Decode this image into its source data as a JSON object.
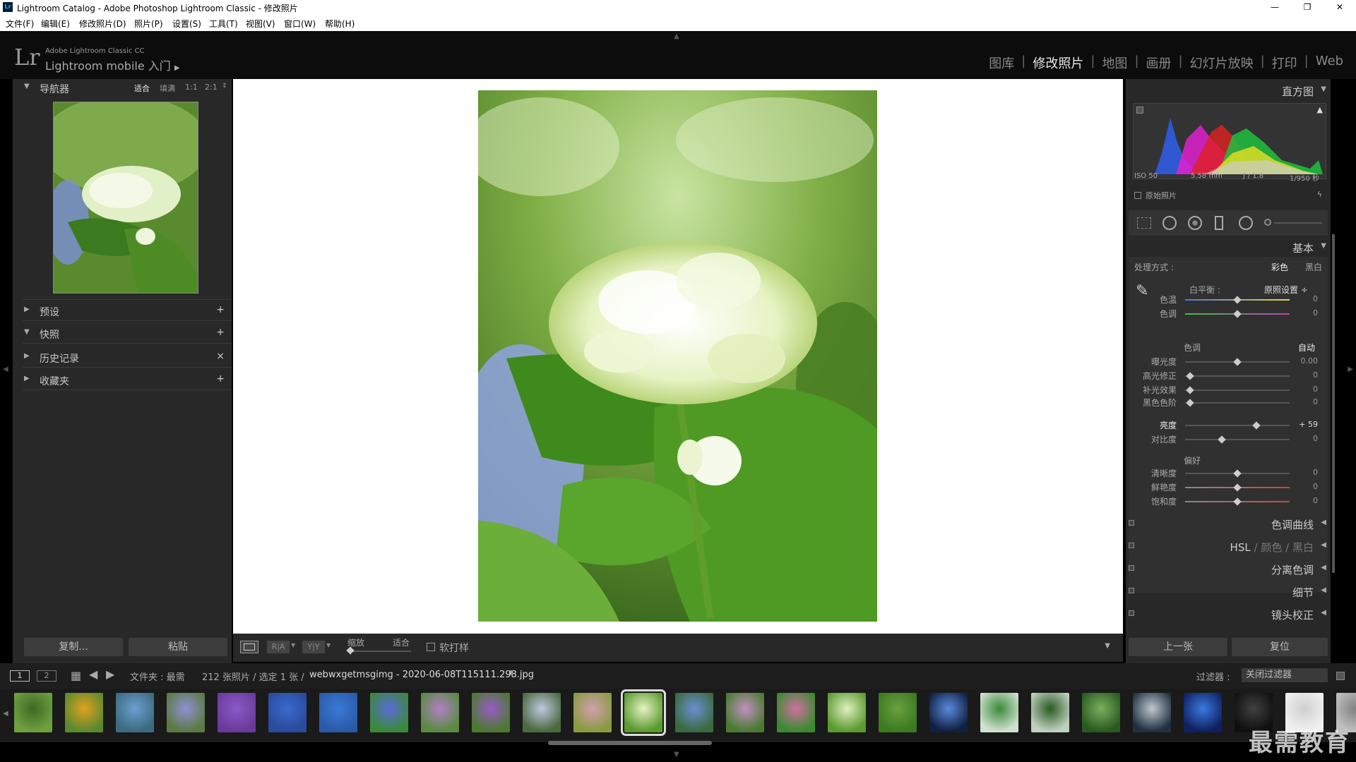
{
  "titlebar": {
    "title": "Lightroom Catalog - Adobe Photoshop Lightroom Classic - 修改照片",
    "icon_text": "Lr",
    "min": "—",
    "max": "❐",
    "close": "✕"
  },
  "menubar": {
    "items": [
      "文件(F)",
      "编辑(E)",
      "修改照片(D)",
      "照片(P)",
      "设置(S)",
      "工具(T)",
      "视图(V)",
      "窗口(W)",
      "帮助(H)"
    ]
  },
  "identity": {
    "logo": "Lr",
    "line1": "Adobe Lightroom Classic CC",
    "line2": "Lightroom mobile 入门",
    "arrow": "▶"
  },
  "modules": [
    "图库",
    "修改照片",
    "地图",
    "画册",
    "幻灯片放映",
    "打印",
    "Web"
  ],
  "left": {
    "navigator": {
      "title": "导航器",
      "zoom_options": [
        "适合",
        "填满",
        "1:1",
        "2:1"
      ]
    },
    "panels": [
      {
        "label": "预设",
        "action": "+"
      },
      {
        "label": "快照",
        "action": "+"
      },
      {
        "label": "历史记录",
        "action": "×"
      },
      {
        "label": "收藏夹",
        "action": "+"
      }
    ],
    "copy_btn": "复制...",
    "paste_btn": "粘贴"
  },
  "toolbar": {
    "zoom_label": "缩放",
    "zoom_value": "适合",
    "soft_proof": "软打样",
    "ra_label": "R|A",
    "yy_label": "Y|Y"
  },
  "right": {
    "histogram": {
      "title": "直方图",
      "iso": "ISO 50",
      "focal": "5.58 mm",
      "aperture": "ƒ / 1.8",
      "shutter": "1/950 秒",
      "original": "原始照片"
    },
    "basic": {
      "title": "基本",
      "treatment_label": "处理方式 :",
      "color": "彩色",
      "bw": "黑白",
      "wb_label": "白平衡 :",
      "wb_value": "原照设置 ÷",
      "temp": {
        "label": "色温",
        "value": "0"
      },
      "tint": {
        "label": "色调",
        "value": "0"
      },
      "tone_label": "色调",
      "auto": "自动",
      "exposure": {
        "label": "曝光度",
        "value": "0.00"
      },
      "highlights": {
        "label": "高光修正",
        "value": "0"
      },
      "fill": {
        "label": "补光效果",
        "value": "0"
      },
      "blacks": {
        "label": "黑色色阶",
        "value": "0"
      },
      "brightness": {
        "label": "亮度",
        "value": "+ 59"
      },
      "contrast": {
        "label": "对比度",
        "value": "0"
      },
      "presence_label": "偏好",
      "clarity": {
        "label": "清晰度",
        "value": "0"
      },
      "vibrance": {
        "label": "鲜艳度",
        "value": "0"
      },
      "saturation": {
        "label": "饱和度",
        "value": "0"
      }
    },
    "sections": [
      "色调曲线",
      "分离色调",
      "细节",
      "镜头校正"
    ],
    "hsl": {
      "hsl": "HSL",
      "color": "颜色",
      "bw": "黑白",
      "sep": "/"
    },
    "prev_btn": "上一张",
    "reset_btn": "复位"
  },
  "bottombar": {
    "view1": "1",
    "view2": "2",
    "folder_text": "文件夹 : 最需",
    "count_text": "212 张照片 / 选定 1 张 /",
    "filename": "webwxgetmsgimg - 2020-06-08T115111.298.jpg",
    "filter_label": "过滤器 :",
    "filter_value": "关闭过滤器"
  },
  "watermark": "最需教育",
  "colors": {
    "panel": "#282828",
    "accent_active": "#e8e8e8"
  }
}
